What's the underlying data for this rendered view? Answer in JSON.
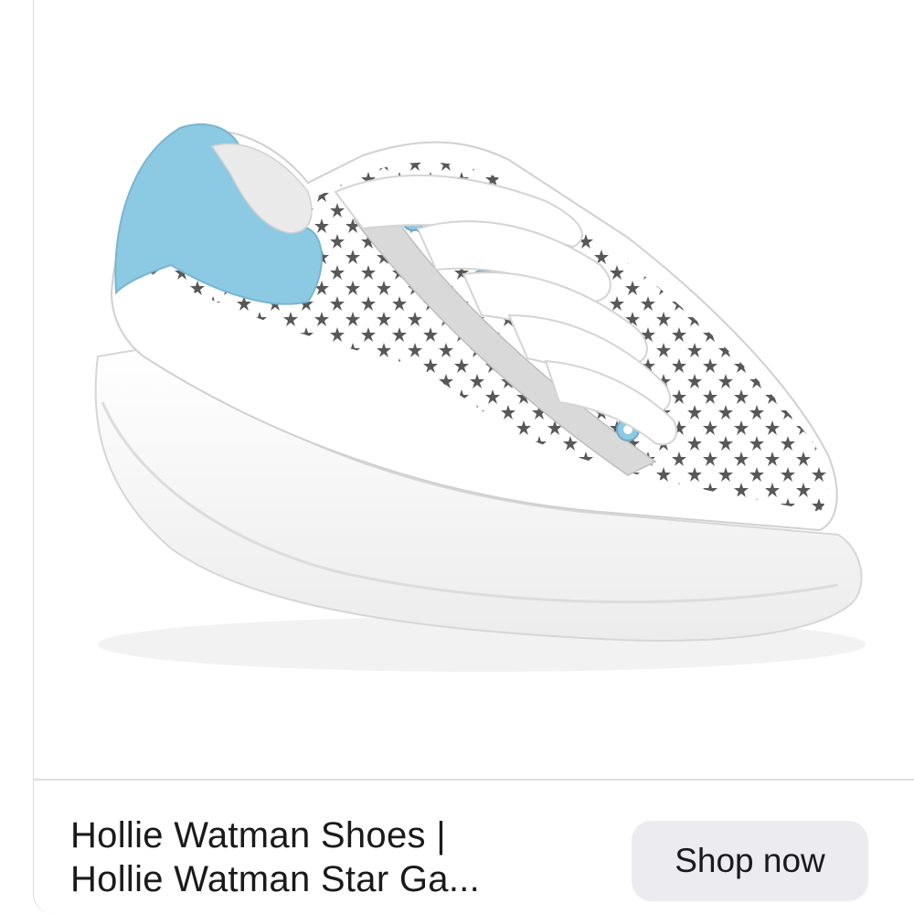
{
  "card": {
    "image_alt": "White star-perforated platform sneaker with light blue heel tab",
    "title_line1": "Hollie Watman Shoes |",
    "title_line2": "Hollie Watman Star Ga...",
    "shop_button_label": "Shop now"
  },
  "colors": {
    "accent_blue": "#8cc9e3",
    "button_bg": "#ebebf0",
    "text": "#1a1a1a"
  }
}
